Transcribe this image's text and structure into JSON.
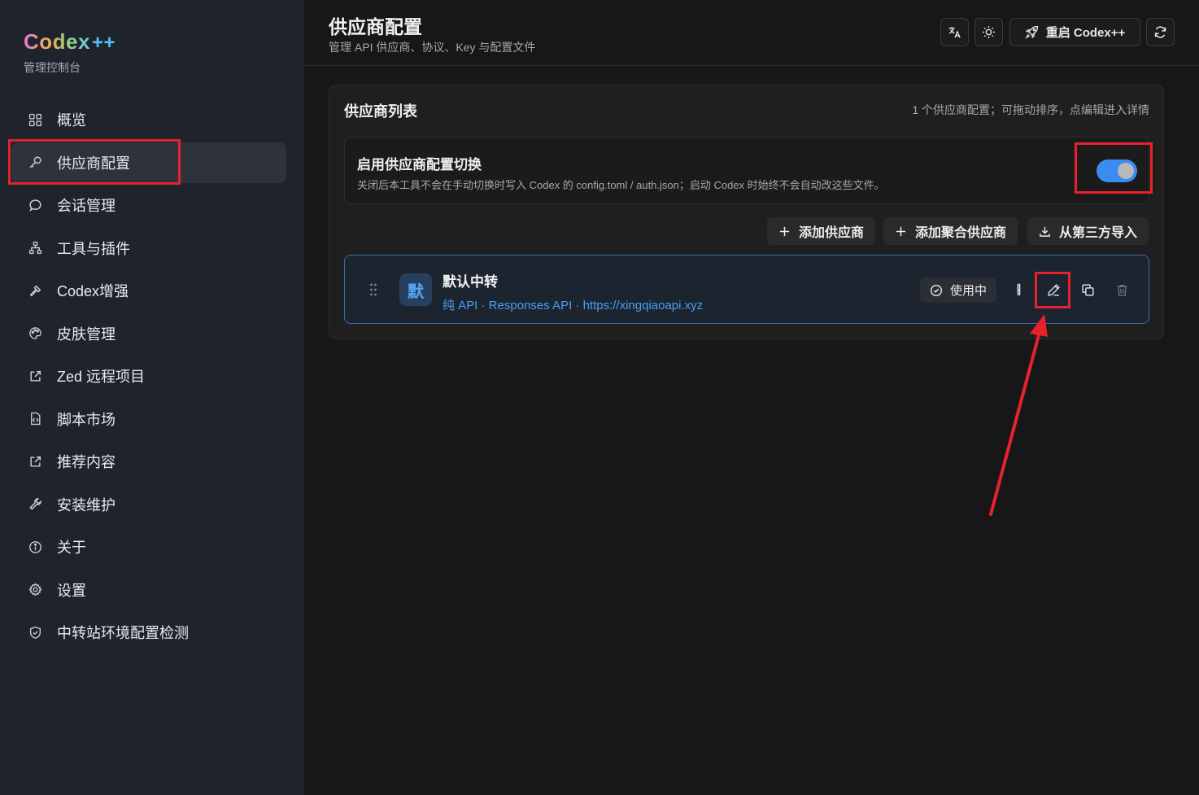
{
  "brand": {
    "name": "Codex",
    "plus": "++",
    "subtitle": "管理控制台"
  },
  "sidebar": {
    "items": [
      {
        "label": "概览",
        "icon": "grid-icon"
      },
      {
        "label": "供应商配置",
        "icon": "key-icon",
        "active": true
      },
      {
        "label": "会话管理",
        "icon": "chat-bubble-icon"
      },
      {
        "label": "工具与插件",
        "icon": "hierarchy-icon"
      },
      {
        "label": "Codex增强",
        "icon": "hammer-icon"
      },
      {
        "label": "皮肤管理",
        "icon": "palette-icon"
      },
      {
        "label": "Zed 远程项目",
        "icon": "external-link-icon"
      },
      {
        "label": "脚本市场",
        "icon": "file-code-icon"
      },
      {
        "label": "推荐内容",
        "icon": "external-link-icon"
      },
      {
        "label": "安装维护",
        "icon": "wrench-icon"
      },
      {
        "label": "关于",
        "icon": "info-icon"
      },
      {
        "label": "设置",
        "icon": "gear-icon"
      },
      {
        "label": "中转站环境配置检测",
        "icon": "shield-check-icon"
      }
    ]
  },
  "header": {
    "title": "供应商配置",
    "subtitle": "管理 API 供应商、协议、Key 与配置文件",
    "restart_label": "重启 Codex++"
  },
  "card": {
    "title": "供应商列表",
    "hint": "1 个供应商配置；可拖动排序，点编辑进入详情",
    "switch": {
      "title": "启用供应商配置切换",
      "description": "关闭后本工具不会在手动切换时写入 Codex 的 config.toml / auth.json；启动 Codex 时始终不会自动改这些文件。",
      "enabled": true
    },
    "actions": {
      "add_provider": "添加供应商",
      "add_aggregate": "添加聚合供应商",
      "import_third_party": "从第三方导入"
    },
    "providers": [
      {
        "avatar": "默",
        "name": "默认中转",
        "meta": "纯 API · Responses API · https://xingqiaoapi.xyz",
        "status": "使用中"
      }
    ]
  },
  "colors": {
    "accent": "#3b8cf0",
    "link": "#4a9ff0",
    "annotation": "#e8222c"
  }
}
